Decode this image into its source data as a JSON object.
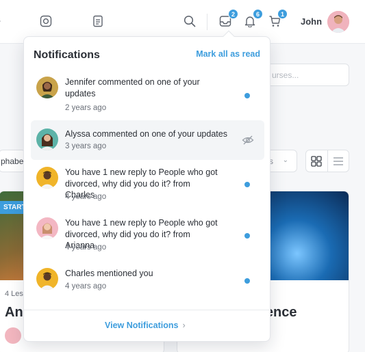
{
  "header": {
    "user_name": "John",
    "badges": {
      "messages": "2",
      "notifications": "6",
      "cart": "1"
    },
    "icons": [
      "record-icon",
      "document-icon",
      "search-icon",
      "inbox-icon",
      "bell-icon",
      "cart-icon"
    ]
  },
  "background": {
    "search_placeholder": "urses...",
    "sort_select_text": "phabe",
    "filter_select_text": "s",
    "start_badge": "START",
    "card_left_meta": "4 Les",
    "card_left_title": "An",
    "card_right_title": "lligence"
  },
  "notifications": {
    "title": "Notifications",
    "mark_all": "Mark all as read",
    "items": [
      {
        "text": "Jennifer commented on one of your updates",
        "time": "2 years ago",
        "unread": true
      },
      {
        "text": "Alyssa commented on one of your updates",
        "time": "3 years ago",
        "unread": false
      },
      {
        "text": "You have 1 new reply to People who got divorced, why did you do it? from Charles",
        "time": "4 years ago",
        "unread": true
      },
      {
        "text": "You have 1 new reply to People who got divorced, why did you do it? from Arianna",
        "time": "4 years ago",
        "unread": true
      },
      {
        "text": "Charles mentioned you",
        "time": "4 years ago",
        "unread": true
      }
    ],
    "view_all": "View Notifications"
  },
  "colors": {
    "accent": "#3d9ddd"
  }
}
